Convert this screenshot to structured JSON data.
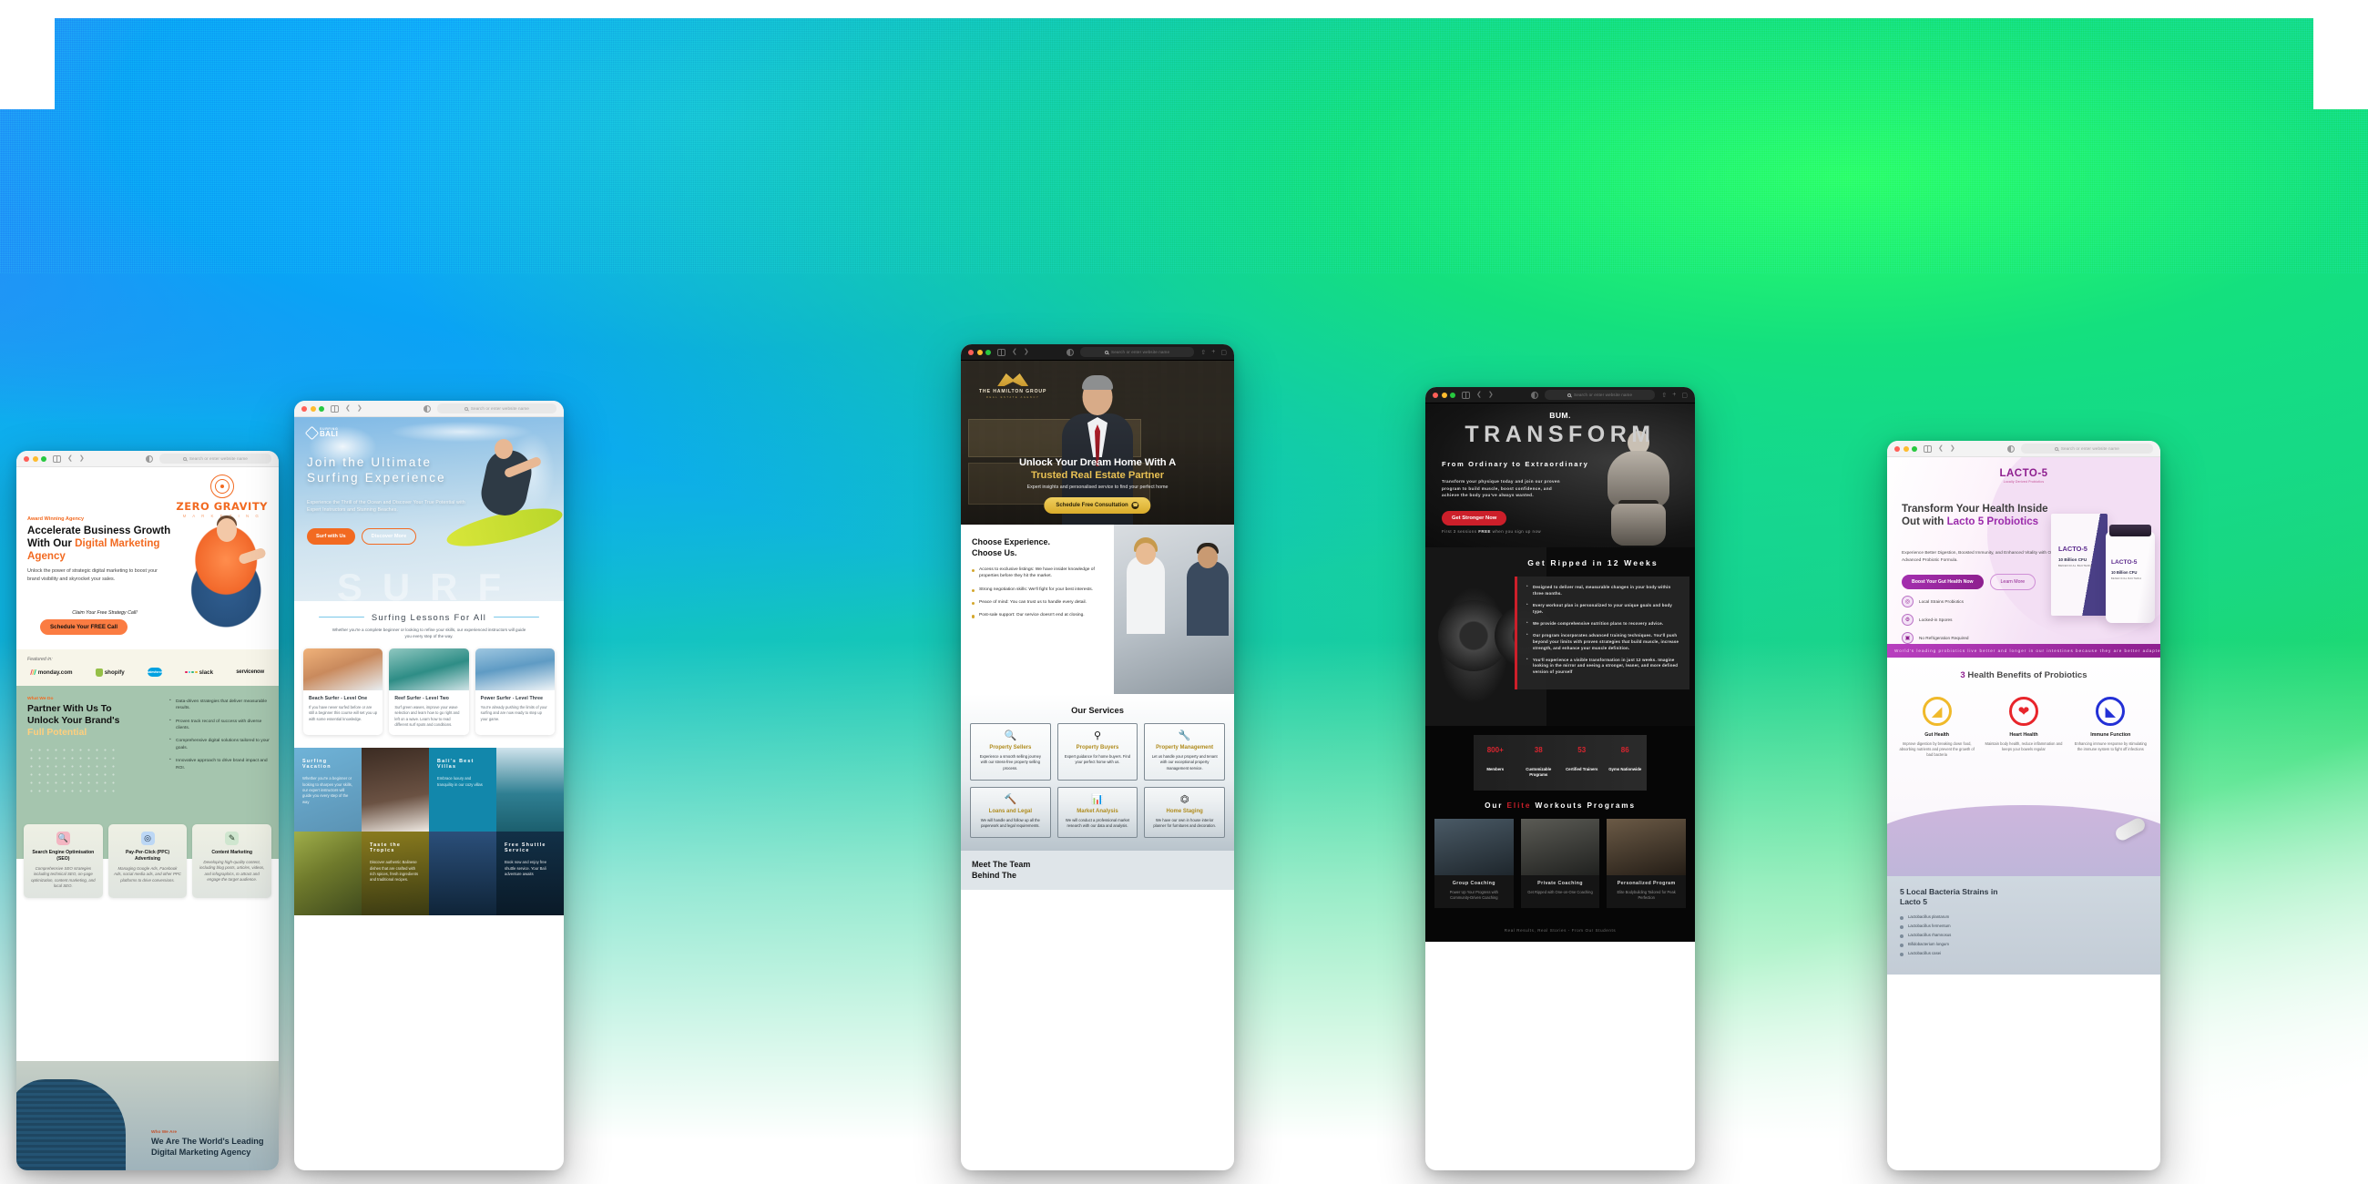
{
  "browser_chrome": {
    "search_placeholder": "Search or enter website name",
    "traffic_lights": [
      "close",
      "minimize",
      "maximize"
    ]
  },
  "windows": [
    {
      "id": "zero-gravity",
      "brand": {
        "name": "ZERO GRAVITY",
        "tagline": "M A R K E T I N G"
      },
      "hero": {
        "kicker": "Award Winning Agency",
        "heading_line1": "Accelerate Business Growth With",
        "heading_line2_plain": "Our ",
        "heading_line2_accent": "Digital Marketing Agency",
        "subtext": "Unlock the power of strategic digital marketing to boost your brand visibility and skyrocket your sales.",
        "claim": "Claim Your Free Strategy Call!",
        "cta": "Schedule Your FREE Call"
      },
      "featured": {
        "label": "Featured in:",
        "logos": [
          "monday.com",
          "shopify",
          "salesforce",
          "slack",
          "servicenow"
        ]
      },
      "partner": {
        "kicker": "What We Do",
        "heading_line1": "Partner With Us To",
        "heading_line2": "Unlock Your Brand's",
        "heading_line3_accent": "Full Potential",
        "bullets": [
          "Data-driven strategies that deliver measurable results.",
          "Proven track record of success with diverse clients.",
          "Comprehensive digital solutions tailored to your goals.",
          "Innovative approach to drive brand impact and ROI."
        ]
      },
      "services": [
        {
          "icon": "seo-icon",
          "title": "Search Engine Optimisation (SEO)",
          "desc": "Comprehensive SEO strategies including technical SEO, on-page optimization, content marketing, and local SEO."
        },
        {
          "icon": "cursor-click-icon",
          "title": "Pay-Per-Click (PPC) Advertising",
          "desc": "Managing Google Ads, Facebook Ads, social media ads, and other PPC platforms to drive conversions."
        },
        {
          "icon": "content-icon",
          "title": "Content Marketing",
          "desc": "Developing high-quality content, including blog posts, articles, videos, and infographics, to attract and engage the target audience."
        }
      ],
      "who": {
        "kicker": "Who We Are",
        "heading": "We Are The World's Leading Digital Marketing Agency"
      }
    },
    {
      "id": "surfing-bali",
      "brand": {
        "top": "SURFING",
        "name": "BALI"
      },
      "hero": {
        "heading_line1": "Join the Ultimate",
        "heading_line2": "Surfing Experience",
        "subtext": "Experience the Thrill of the Ocean and Discover Your True Potential with Expert Instructors and Stunning Beaches.",
        "cta_primary": "Surf with Us",
        "cta_secondary": "Discover More",
        "watermark": "SURF"
      },
      "lessons": {
        "title": "Surfing Lessons For All",
        "lead": "Whether you're a complete beginner or looking to refine your skills, our experienced instructors will guide you every step of the way.",
        "cards": [
          {
            "title": "Beach Surfer - Level One",
            "desc": "If you have never surfed before or are still a beginner this course will set you up with some essential knowledge."
          },
          {
            "title": "Reef Surfer - Level Two",
            "desc": "Surf green waves, improve your wave selection and learn how to go right and left on a wave. Learn how to read different surf spots and conditions."
          },
          {
            "title": "Power Surfer - Level Three",
            "desc": "You're already pushing the limits of your surfing and are now ready to step up your game."
          }
        ]
      },
      "grid": [
        {
          "title": "Surfing Vacation",
          "desc": "Whether you're a beginner or looking to sharpen your skills, our expert instructors will guide you every step of the way"
        },
        {
          "title": "",
          "desc": ""
        },
        {
          "title": "Bali's Best Villas",
          "desc": "Embrace luxury and tranquility in our cozy villas"
        },
        {
          "title": "",
          "desc": ""
        },
        {
          "title": "",
          "desc": ""
        },
        {
          "title": "Taste the Tropics",
          "desc": "Discover authentic Balinese dishes that are crafted with rich spices, fresh ingredients and traditional recipes."
        },
        {
          "title": "",
          "desc": ""
        },
        {
          "title": "Free Shuttle Service",
          "desc": "Book now and enjoy free shuttle service. Your Bali adventure awaits"
        }
      ]
    },
    {
      "id": "hamilton-group",
      "brand": {
        "name": "THE HAMILTON GROUP",
        "tagline": "REAL ESTATE AGENCY"
      },
      "hero": {
        "heading_line1": "Unlock Your Dream Home With A",
        "heading_line2_accent": "Trusted Real Estate Partner",
        "subtext": "Expert insights and personalised service to find your perfect home",
        "cta": "Schedule Free Consultation"
      },
      "choose": {
        "heading_line1": "Choose Experience.",
        "heading_line2": "Choose Us.",
        "bullets": [
          "Access to exclusive listings: We have insider knowledge of properties before they hit the market.",
          "Strong negotiation skills: We'll fight for your best interests.",
          "Peace of mind: You can trust us to handle every detail.",
          "Post-sale support: Our service doesn't end at closing."
        ]
      },
      "services": {
        "title": "Our Services",
        "cards": [
          {
            "icon": "magnifier-icon",
            "title": "Property Sellers",
            "desc": "Experience a smooth selling journey with our stress-free property selling process."
          },
          {
            "icon": "home-search-icon",
            "title": "Property Buyers",
            "desc": "Expert guidance for home buyers. Find your perfect home with us."
          },
          {
            "icon": "wrench-icon",
            "title": "Property Management",
            "desc": "Let us handle your property and tenant with our exceptional property management service."
          },
          {
            "icon": "gavel-icon",
            "title": "Loans and Legal",
            "desc": "We will handle and follow up all the paperwork and legal requirements."
          },
          {
            "icon": "bar-chart-icon",
            "title": "Market Analysis",
            "desc": "We will conduct a professional market research with our data and analysis."
          },
          {
            "icon": "table-icon",
            "title": "Home Staging",
            "desc": "We have our own in house interior planner for furnitures and decoration."
          }
        ]
      },
      "team": {
        "heading_line1": "Meet The Team",
        "heading_line2": "Behind The"
      }
    },
    {
      "id": "bum-transform",
      "brand": {
        "name": "BUM."
      },
      "hero": {
        "title": "TRANSFORM",
        "subtitle": "From Ordinary to Extraordinary",
        "paragraph": "Transform your physique today and join our proven program to build muscle, boost confidence, and achieve the body you've always wanted.",
        "cta": "Get Stronger Now",
        "note_pre": "First 3 sessions ",
        "note_bold": "FREE",
        "note_post": " when you sign up now"
      },
      "ripped": {
        "title": "Get Ripped in 12 Weeks",
        "bullets": [
          "Designed to deliver real, measurable changes in your body within three months.",
          "Every workout plan is personalized to your unique goals and body type.",
          "We provide comprehensive nutrition plans to recovery advice.",
          "Our program incorporates advanced training techniques. You'll push beyond your limits with proven strategies that build muscle, increase strength, and enhance your muscle definition.",
          "You'll experience a visible transformation in just 12 weeks. Imagine looking in the mirror and seeing a stronger, leaner, and more defined version of yourself"
        ]
      },
      "stats": [
        {
          "number": "800+",
          "label": "Members"
        },
        {
          "number": "38",
          "label": "Customizable Programs"
        },
        {
          "number": "53",
          "label": "Certified Trainers"
        },
        {
          "number": "86",
          "label": "Gyms Nationwide"
        }
      ],
      "programs": {
        "title_pre": "Our ",
        "title_accent": "Elite",
        "title_post": " Workouts Programs",
        "cards": [
          {
            "title": "Group Coaching",
            "desc": "Power Up Your Progress with Community-Driven Coaching"
          },
          {
            "title": "Private Coaching",
            "desc": "Get Ripped with One-on-One Coaching"
          },
          {
            "title": "Personalized Program",
            "desc": "Elite Bodybuilding Tailored for Peak Perfection"
          }
        ]
      },
      "footer": "Real Results, Real Stories - From Our Students"
    },
    {
      "id": "lacto-5",
      "brand": {
        "name": "LACTO-5",
        "tagline": "Locally Derived Probiotics"
      },
      "hero": {
        "heading_line1": "Transform Your Health Inside",
        "heading_line2_plain": "Out with ",
        "heading_line2_accent": "Lacto 5 Probiotics",
        "subtext": "Experience Better Digestion, Boosted Immunity, and Enhanced Vitality with Our Advanced Probiotic Formula.",
        "cta_primary": "Boost Your Gut Health Now",
        "cta_secondary": "Learn More",
        "features": [
          {
            "icon": "bacteria-icon",
            "label": "Local Strains Probiotics"
          },
          {
            "icon": "spore-icon",
            "label": "Locked-in Spores"
          },
          {
            "icon": "no-fridge-icon",
            "label": "No Refrigeration Required"
          }
        ],
        "product": {
          "name": "LACTO-5",
          "dose": "10 Billion CFU",
          "sub": "BENEFICIAL BACTERIA"
        }
      },
      "ticker": "World's leading probiotics live better and longer in our intestines because they are better adapted to our local conditions",
      "benefits": {
        "title_number": "3",
        "title_rest": " Health Benefits of Probiotics",
        "cards": [
          {
            "icon": "stomach-icon",
            "title": "Gut Health",
            "desc": "Improve digestion by breaking down food, absorbing nutrients and prevent the growth of bad bacteria"
          },
          {
            "icon": "heart-icon",
            "title": "Heart Health",
            "desc": "Maintain body health, reduce inflammation and keeps your bowels regular"
          },
          {
            "icon": "bicep-icon",
            "title": "Immune Function",
            "desc": "Enhancing immune response by stimulating the immune system to fight off infections"
          }
        ]
      },
      "strains": {
        "heading_line1": "5 Local Bacteria Strains in",
        "heading_line2": "Lacto 5",
        "items": [
          "Lactobacillus plantarum",
          "Lactobacillus fermentum",
          "Lactobacillus rhamnosus",
          "Bifidobacterium longum",
          "Lactobacillus casei"
        ]
      }
    }
  ]
}
